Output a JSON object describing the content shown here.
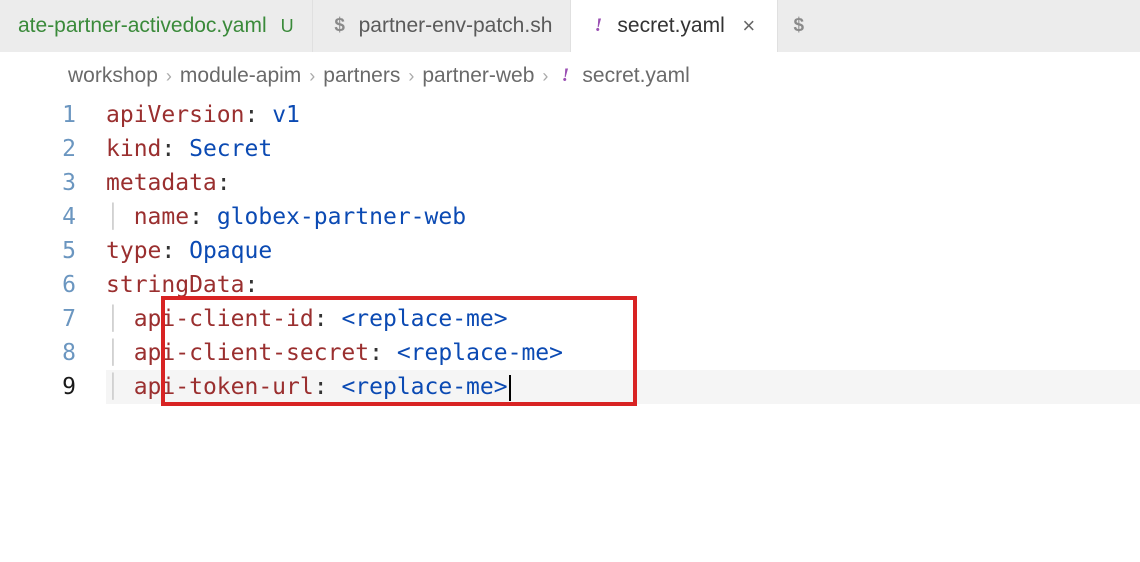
{
  "tabs": [
    {
      "icon": "yaml",
      "label": "ate-partner-activedoc.yaml",
      "status": "U",
      "active": false,
      "modified": true
    },
    {
      "icon": "shell",
      "label": "partner-env-patch.sh",
      "status": "",
      "active": false,
      "modified": false
    },
    {
      "icon": "yaml",
      "label": "secret.yaml",
      "status": "",
      "active": true,
      "modified": false
    }
  ],
  "breadcrumb": {
    "segments": [
      "workshop",
      "module-apim",
      "partners",
      "partner-web"
    ],
    "fileIcon": "yaml",
    "fileName": "secret.yaml"
  },
  "code": {
    "lines": [
      {
        "n": "1",
        "indent": 0,
        "key": "apiVersion",
        "val": "v1",
        "valClass": "k-val-v1"
      },
      {
        "n": "2",
        "indent": 0,
        "key": "kind",
        "val": "Secret",
        "valClass": "k-val-secret"
      },
      {
        "n": "3",
        "indent": 0,
        "key": "metadata",
        "val": "",
        "valClass": ""
      },
      {
        "n": "4",
        "indent": 1,
        "key": "name",
        "val": "globex-partner-web",
        "valClass": "k-val-name"
      },
      {
        "n": "5",
        "indent": 0,
        "key": "type",
        "val": "Opaque",
        "valClass": "k-val-opaque"
      },
      {
        "n": "6",
        "indent": 0,
        "key": "stringData",
        "val": "",
        "valClass": ""
      },
      {
        "n": "7",
        "indent": 1,
        "key": "api-client-id",
        "val": "<replace-me>",
        "valClass": "k-replace"
      },
      {
        "n": "8",
        "indent": 1,
        "key": "api-client-secret",
        "val": "<replace-me>",
        "valClass": "k-replace"
      },
      {
        "n": "9",
        "indent": 1,
        "key": "api-token-url",
        "val": "<replace-me>",
        "valClass": "k-replace"
      }
    ],
    "currentLine": 9
  },
  "icons": {
    "yaml": "!",
    "shell": "$",
    "close": "×",
    "chevron": "›"
  }
}
